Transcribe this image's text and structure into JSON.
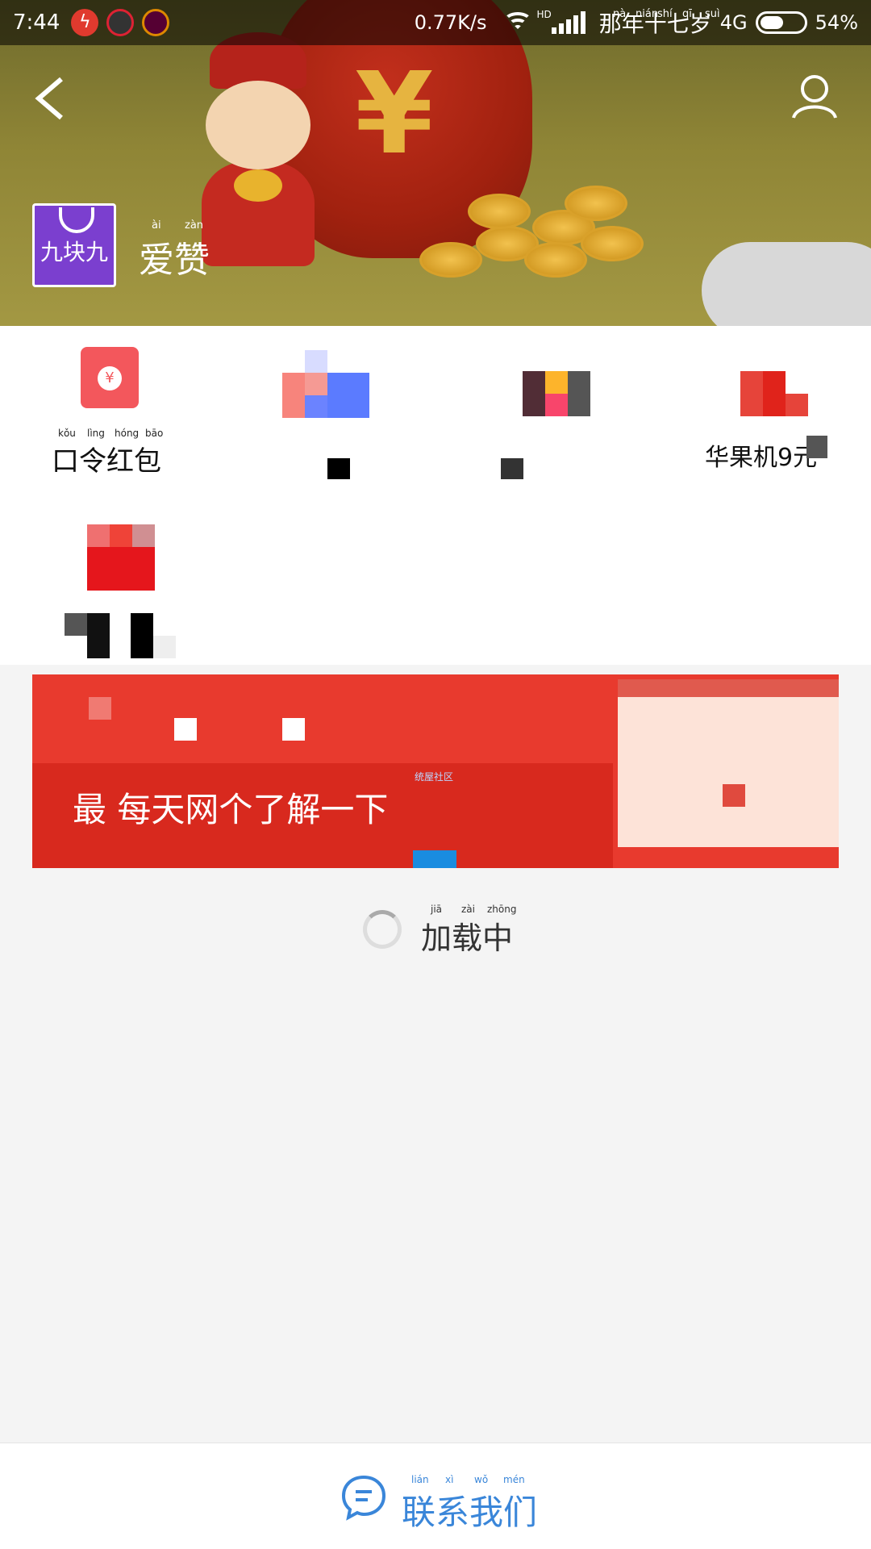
{
  "status_bar": {
    "time": "7:44",
    "net_speed": "0.77K/s",
    "wifi_label": "HD",
    "carrier": "那年十七岁",
    "carrier_pinyin": [
      "nà",
      "nián",
      "shí",
      "qī",
      "suì"
    ],
    "network": "4G",
    "battery": "54%",
    "battery_level": 0.54
  },
  "header": {
    "app_logo_text": "九块九",
    "app_name": "爱赞",
    "app_name_pinyin": [
      "ài",
      "zàn"
    ]
  },
  "grid": {
    "item1_label": "口令红包",
    "item1_pinyin": [
      "kǒu",
      "lìng",
      "hóng",
      "bāo"
    ],
    "item4_partial_label": "华果机9元"
  },
  "ad": {
    "tiny_label": "统屋社区",
    "headline": "最          每天网个了解一下"
  },
  "loading": {
    "text": "加载中",
    "pinyin": [
      "jiā",
      "zài",
      "zhōng"
    ]
  },
  "footer": {
    "contact_label": "联系我们",
    "contact_pinyin": [
      "lián",
      "xì",
      "wǒ",
      "mén"
    ]
  },
  "colors": {
    "accent_blue": "#3a86d9",
    "ad_red": "#e83a2e",
    "logo_purple": "#7b3fcf"
  }
}
